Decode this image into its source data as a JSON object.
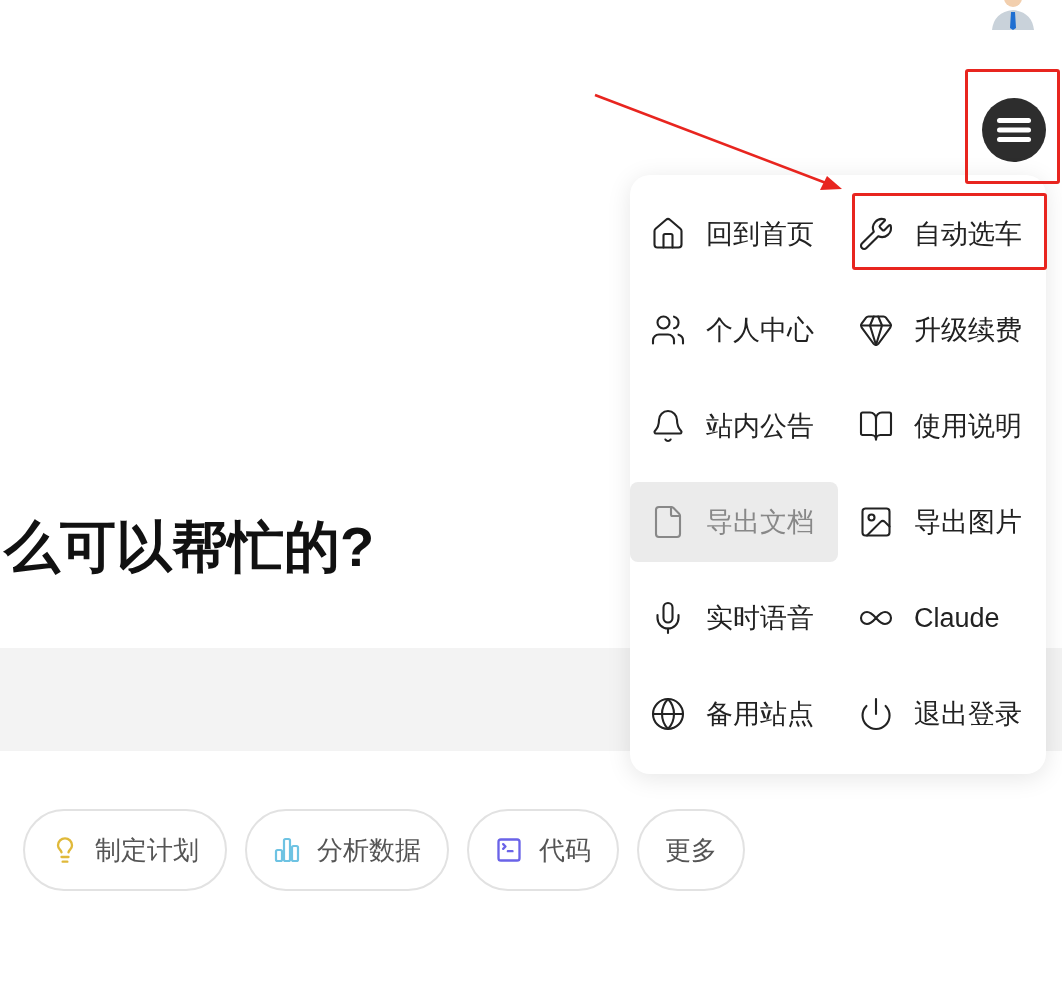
{
  "heading": "么可以帮忙的?",
  "chips": [
    {
      "label": "制定计划",
      "kind": "plan"
    },
    {
      "label": "分析数据",
      "kind": "data"
    },
    {
      "label": "代码",
      "kind": "code"
    },
    {
      "label": "更多",
      "kind": "more"
    }
  ],
  "menu": {
    "items": [
      {
        "label": "回到首页",
        "kind": "home",
        "selected": false
      },
      {
        "label": "自动选车",
        "kind": "tools",
        "selected": false
      },
      {
        "label": "个人中心",
        "kind": "user",
        "selected": false
      },
      {
        "label": "升级续费",
        "kind": "diamond",
        "selected": false
      },
      {
        "label": "站内公告",
        "kind": "bell",
        "selected": false
      },
      {
        "label": "使用说明",
        "kind": "book",
        "selected": false
      },
      {
        "label": "导出文档",
        "kind": "file",
        "selected": true
      },
      {
        "label": "导出图片",
        "kind": "image",
        "selected": false
      },
      {
        "label": "实时语音",
        "kind": "mic",
        "selected": false
      },
      {
        "label": "Claude",
        "kind": "infinity",
        "selected": false
      },
      {
        "label": "备用站点",
        "kind": "globe",
        "selected": false
      },
      {
        "label": "退出登录",
        "kind": "power",
        "selected": false
      }
    ]
  }
}
